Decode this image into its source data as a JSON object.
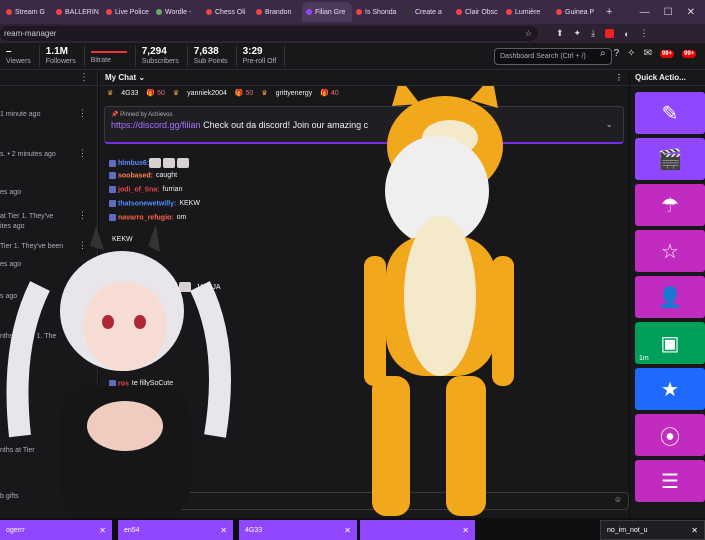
{
  "browser": {
    "tabs": [
      {
        "label": "Stream G",
        "color": "#e44"
      },
      {
        "label": "BALLERIN",
        "color": "#e44"
      },
      {
        "label": "Live Police",
        "color": "#e44"
      },
      {
        "label": "Wordle -",
        "color": "#6aaa64"
      },
      {
        "label": "Chess Oli",
        "color": "#e44"
      },
      {
        "label": "Brandon",
        "color": "#e44"
      },
      {
        "label": "Filian Gre",
        "color": "#9147ff"
      },
      {
        "label": "Is Shonda",
        "color": "#e44"
      },
      {
        "label": "Create a",
        "color": "#333"
      },
      {
        "label": "Clair Obsc",
        "color": "#e44"
      },
      {
        "label": "Lumière",
        "color": "#e44"
      },
      {
        "label": "Guinea P",
        "color": "#e44"
      }
    ],
    "url": "ream-manager"
  },
  "stats": [
    {
      "value": "–",
      "label": "Viewers"
    },
    {
      "value": "1.1M",
      "label": "Followers"
    },
    {
      "value": "",
      "label": "Bitrate"
    },
    {
      "value": "7,294",
      "label": "Subscribers"
    },
    {
      "value": "7,638",
      "label": "Sub Points"
    },
    {
      "value": "3:29",
      "label": "Pre-roll Off"
    }
  ],
  "search": {
    "placeholder": "Dashboard Search (Ctrl + /)"
  },
  "notifications": {
    "badge1": "99+",
    "badge2": "99+"
  },
  "activity": [
    {
      "text": "1 minute ago"
    },
    {
      "text": "s. • 2 minutes ago"
    },
    {
      "text": "es ago"
    },
    {
      "text": "at Tier 1. They've"
    },
    {
      "text": "ites ago"
    },
    {
      "text": "Tier 1. They've been"
    },
    {
      "text": "es ago"
    },
    {
      "text": "s ago"
    },
    {
      "text": "nths at Tier 1. The"
    },
    {
      "text": "nths at Tier"
    },
    {
      "text": "b gifts"
    }
  ],
  "chat": {
    "header": "My Chat",
    "gifters": [
      {
        "name": "4G33",
        "count": "50"
      },
      {
        "name": "yanniek2004",
        "count": "50"
      },
      {
        "name": "grittyenergy",
        "count": "40"
      }
    ],
    "pinned_by": "Pinned by Achievos",
    "pinned_link": "https://discord.gg/filian",
    "pinned_text": "Check out da discord! Join our amazing c",
    "messages": [
      {
        "user": "hlmbus6:",
        "text": "",
        "color": "#5b8cff"
      },
      {
        "user": "soobased:",
        "text": "caught",
        "color": "#ff7f50"
      },
      {
        "user": "jodi_of_tina:",
        "text": "furrian",
        "color": "#e0474c"
      },
      {
        "user": "thatsonewetwilly:",
        "text": "KEKW",
        "color": "#4f8cff"
      },
      {
        "user": "navarro_refugio:",
        "text": "om",
        "color": "#ff6347"
      },
      {
        "user": "",
        "text": "KEKW",
        "color": "#efeff1"
      },
      {
        "user": "",
        "text": "JAJAJA",
        "color": "#efeff1"
      },
      {
        "user": "ros",
        "text": "te fillySoCute",
        "color": "#e0474c"
      },
      {
        "user": "",
        "text": "with just happened",
        "color": "#efeff1"
      }
    ]
  },
  "bottom_chips": [
    {
      "label": "ogerrr"
    },
    {
      "label": "en54"
    },
    {
      "label": "4G33"
    },
    {
      "label": ""
    },
    {
      "label": "no_im_not_u"
    }
  ],
  "quick_actions": {
    "title": "Quick Actio...",
    "buttons": [
      {
        "icon": "edit-icon",
        "glyph": "✎",
        "color": "#9147ff",
        "caption": ""
      },
      {
        "icon": "clapperboard-icon",
        "glyph": "🎬",
        "color": "#9147ff",
        "caption": ""
      },
      {
        "icon": "parachute-icon",
        "glyph": "☂",
        "color": "#c22bc0",
        "caption": ""
      },
      {
        "icon": "star-outline-icon",
        "glyph": "☆",
        "color": "#c22bc0",
        "caption": ""
      },
      {
        "icon": "add-user-icon",
        "glyph": "👤",
        "color": "#c22bc0",
        "caption": ""
      },
      {
        "icon": "ad-icon",
        "glyph": "▣",
        "color": "#00a05b",
        "caption": "1m"
      },
      {
        "icon": "star-icon",
        "glyph": "★",
        "color": "#1f69ff",
        "caption": ""
      },
      {
        "icon": "clip-icon",
        "glyph": "⦿",
        "color": "#c22bc0",
        "caption": ""
      },
      {
        "icon": "stack-icon",
        "glyph": "☰",
        "color": "#c22bc0",
        "caption": ""
      }
    ]
  }
}
